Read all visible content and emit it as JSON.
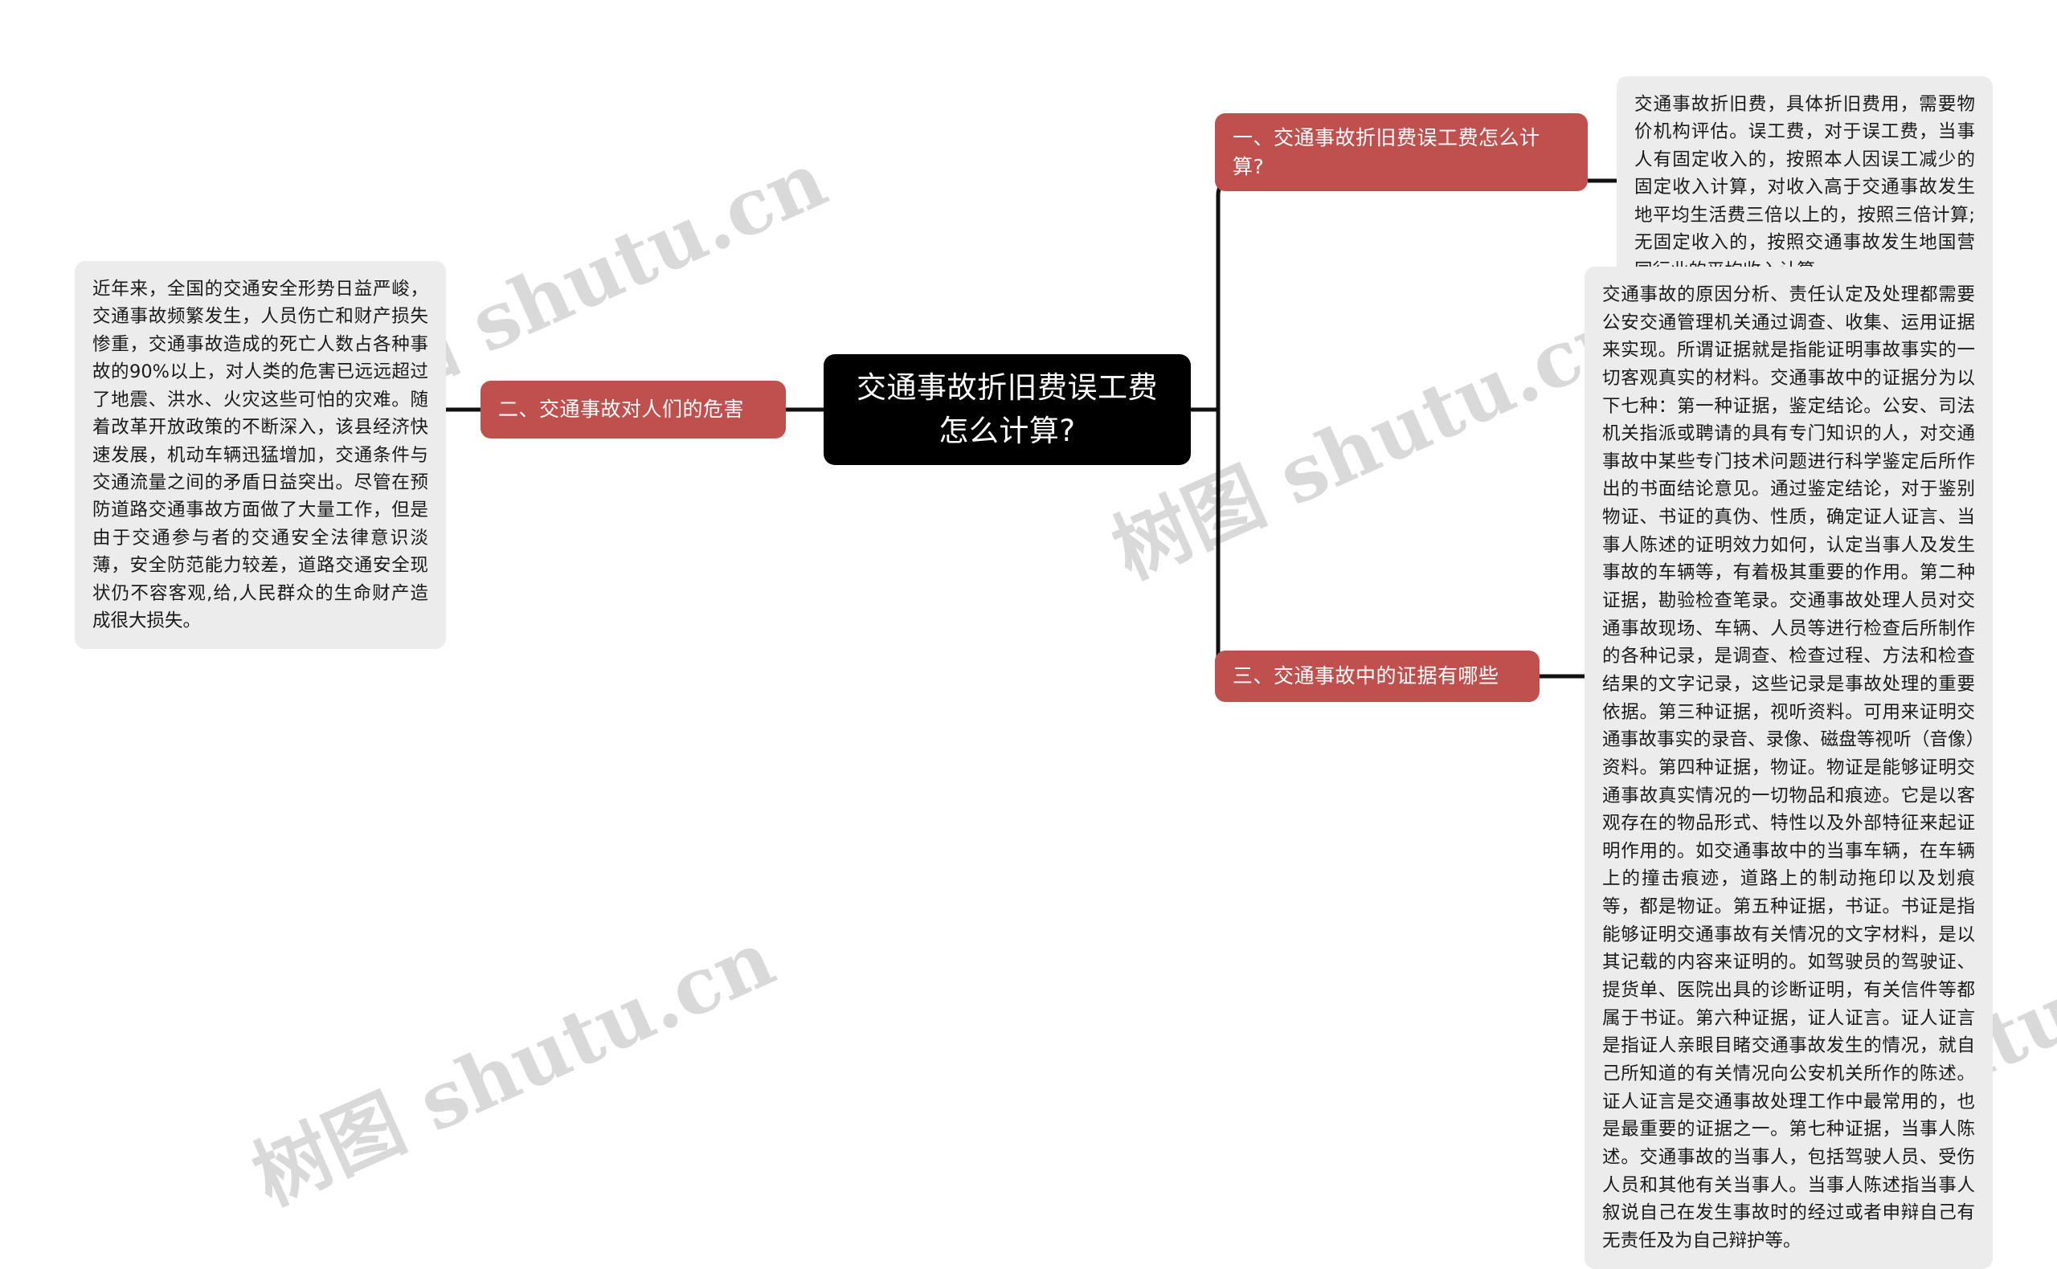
{
  "diagram": {
    "type": "mindmap",
    "watermark_text": "树图 shutu.cn",
    "colors": {
      "root_fill": "#000000",
      "root_text": "#ffffff",
      "branch_fill": "#c0504d",
      "branch_text": "#ffffff",
      "note_fill": "#ececec",
      "note_text": "#1a1a1a",
      "connector": "#111111",
      "background": "#ffffff",
      "watermark": "#d9d9d9"
    },
    "root": {
      "label": "交通事故折旧费误工费怎么计算?"
    },
    "branches": [
      {
        "id": "branch-1",
        "label": "一、交通事故折旧费误工费怎么计算?",
        "note": "交通事故折旧费，具体折旧费用，需要物价机构评估。误工费，对于误工费，当事人有固定收入的，按照本人因误工减少的固定收入计算，对收入高于交通事故发生地平均生活费三倍以上的，按照三倍计算;无固定收入的，按照交通事故发生地国营同行业的平均收入计算。"
      },
      {
        "id": "branch-2",
        "label": "二、交通事故对人们的危害",
        "note": "近年来，全国的交通安全形势日益严峻，交通事故频繁发生，人员伤亡和财产损失惨重，交通事故造成的死亡人数占各种事故的90%以上，对人类的危害已远远超过了地震、洪水、火灾这些可怕的灾难。随着改革开放政策的不断深入，该县经济快速发展，机动车辆迅猛增加，交通条件与交通流量之间的矛盾日益突出。尽管在预防道路交通事故方面做了大量工作，但是由于交通参与者的交通安全法律意识淡薄，安全防范能力较差，道路交通安全现状仍不容客观,给,人民群众的生命财产造成很大损失。"
      },
      {
        "id": "branch-3",
        "label": "三、交通事故中的证据有哪些",
        "note": "交通事故的原因分析、责任认定及处理都需要公安交通管理机关通过调查、收集、运用证据来实现。所谓证据就是指能证明事故事实的一切客观真实的材料。交通事故中的证据分为以下七种：第一种证据，鉴定结论。公安、司法机关指派或聘请的具有专门知识的人，对交通事故中某些专门技术问题进行科学鉴定后所作出的书面结论意见。通过鉴定结论，对于鉴别物证、书证的真伪、性质，确定证人证言、当事人陈述的证明效力如何，认定当事人及发生事故的车辆等，有着极其重要的作用。第二种证据，勘验检查笔录。交通事故处理人员对交通事故现场、车辆、人员等进行检查后所制作的各种记录，是调查、检查过程、方法和检查结果的文字记录，这些记录是事故处理的重要依据。第三种证据，视听资料。可用来证明交通事故事实的录音、录像、磁盘等视听（音像）资料。第四种证据，物证。物证是能够证明交通事故真实情况的一切物品和痕迹。它是以客观存在的物品形式、特性以及外部特征来起证明作用的。如交通事故中的当事车辆，在车辆上的撞击痕迹，道路上的制动拖印以及划痕等，都是物证。第五种证据，书证。书证是指能够证明交通事故有关情况的文字材料，是以其记载的内容来证明的。如驾驶员的驾驶证、提货单、医院出具的诊断证明，有关信件等都属于书证。第六种证据，证人证言。证人证言是指证人亲眼目睹交通事故发生的情况，就自己所知道的有关情况向公安机关所作的陈述。证人证言是交通事故处理工作中最常用的，也是最重要的证据之一。第七种证据，当事人陈述。交通事故的当事人，包括驾驶人员、受伤人员和其他有关当事人。当事人陈述指当事人叙说自己在发生事故时的经过或者申辩自己有无责任及为自己辩护等。"
      }
    ]
  }
}
